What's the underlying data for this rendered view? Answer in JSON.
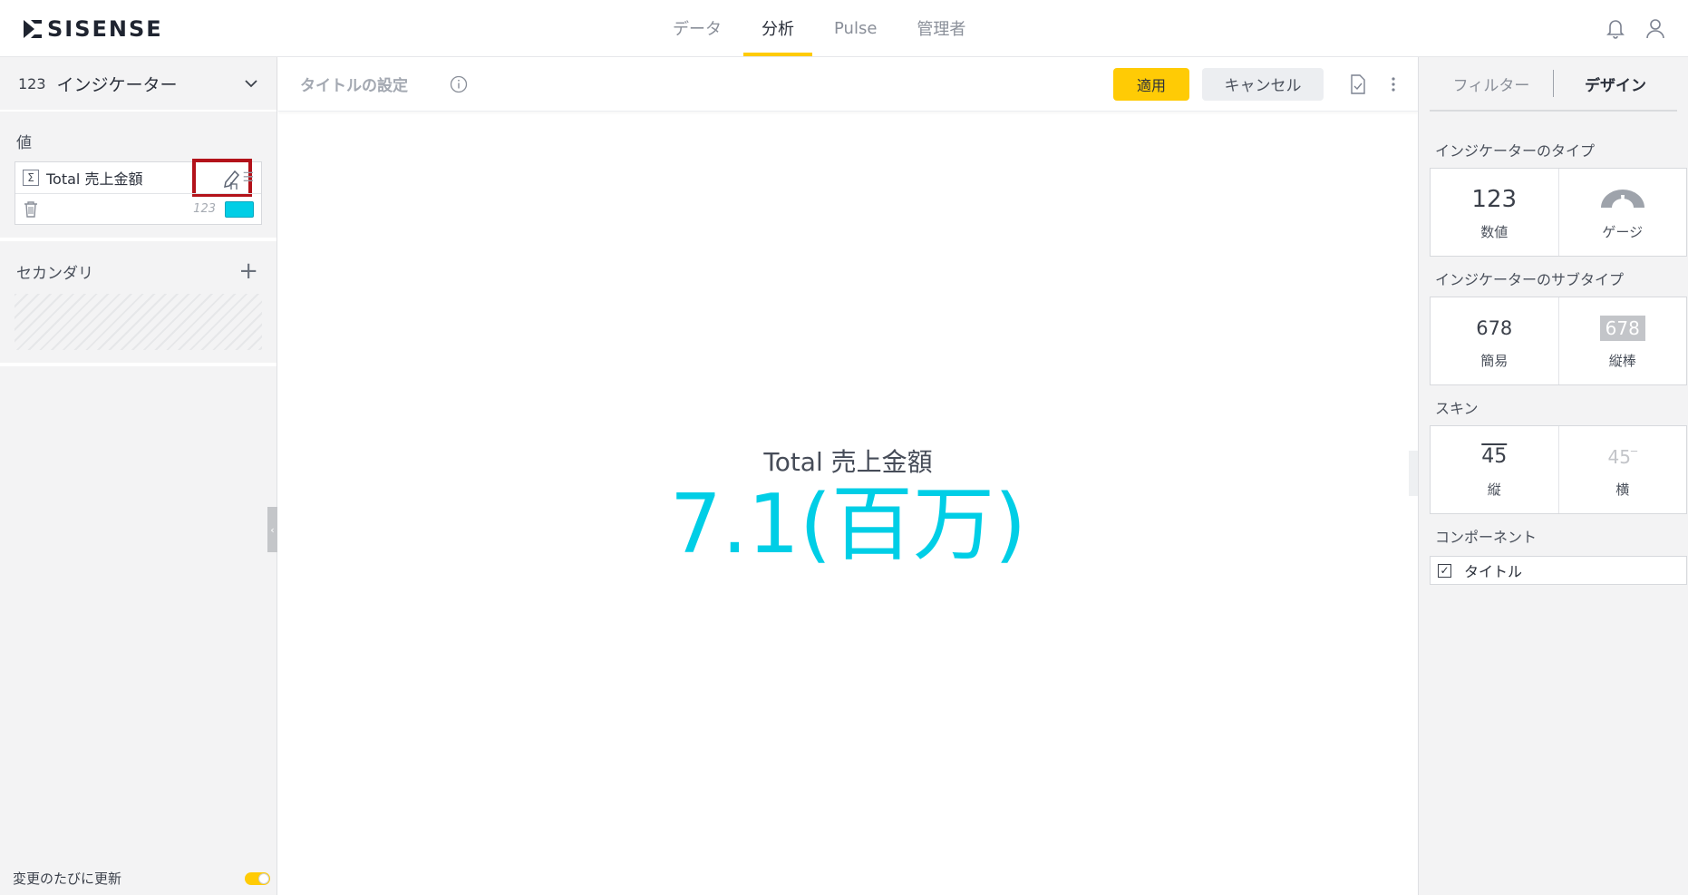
{
  "topbar": {
    "logo": "SISENSE",
    "nav": [
      "データ",
      "分析",
      "Pulse",
      "管理者"
    ],
    "active_nav": "分析"
  },
  "left_panel": {
    "widget_type_icon": "123",
    "widget_type": "インジケーター",
    "value_section": "値",
    "value_item": "Total 売上金額",
    "value_format": "123",
    "value_color": "#00cee6",
    "secondary_section": "セカンダリ",
    "auto_update_label": "変更のたびに更新"
  },
  "center": {
    "title_placeholder": "タイトルの設定",
    "apply_label": "適用",
    "cancel_label": "キャンセル",
    "indicator_title": "Total 売上金額",
    "indicator_value": "7.1(百万)"
  },
  "right_panel": {
    "tab_filter": "フィルター",
    "tab_design": "デザイン",
    "indicator_type_label": "インジケーターのタイプ",
    "type_numeric_icon": "123",
    "type_numeric": "数値",
    "type_gauge": "ゲージ",
    "subtype_label": "インジケーターのサブタイプ",
    "subtype_simple_icon": "678",
    "subtype_simple": "簡易",
    "subtype_bar_icon": "678",
    "subtype_bar": "縦棒",
    "skin_label": "スキン",
    "skin_vertical_icon": "45",
    "skin_vertical": "縦",
    "skin_horizontal_icon": "45",
    "skin_horizontal": "横",
    "component_label": "コンポーネント",
    "component_title": "タイトル"
  }
}
